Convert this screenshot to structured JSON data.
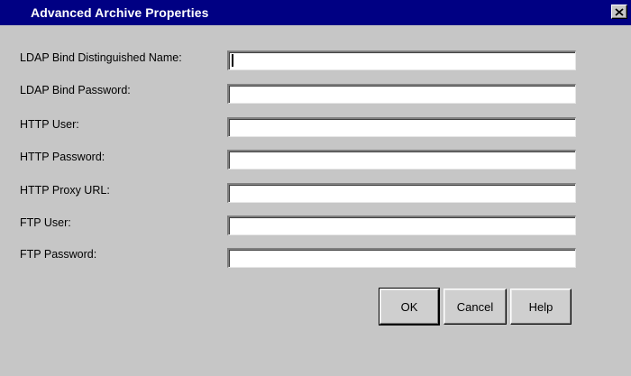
{
  "window": {
    "title": "Advanced Archive Properties",
    "close_icon": "close-icon"
  },
  "form": {
    "fields": [
      {
        "label": "LDAP Bind Distinguished Name:",
        "value": ""
      },
      {
        "label": "LDAP Bind Password:",
        "value": ""
      },
      {
        "label": "HTTP User:",
        "value": ""
      },
      {
        "label": "HTTP Password:",
        "value": ""
      },
      {
        "label": "HTTP Proxy URL:",
        "value": ""
      },
      {
        "label": "FTP User:",
        "value": ""
      },
      {
        "label": "FTP Password:",
        "value": ""
      }
    ]
  },
  "buttons": {
    "ok": "OK",
    "cancel": "Cancel",
    "help": "Help"
  },
  "colors": {
    "titlebar": "#000083",
    "dialog_bg": "#c6c6c6"
  }
}
